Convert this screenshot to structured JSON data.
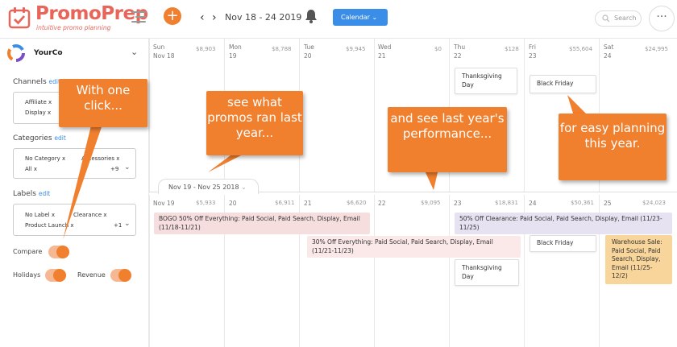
{
  "brand": {
    "name": "PromoPrep",
    "tagline": "intuitive promo planning"
  },
  "topbar": {
    "add": "+",
    "prev": "‹",
    "next": "›",
    "date_range": "Nov 18 - 24 2019",
    "view_label": "Calendar",
    "search_placeholder": "Search",
    "more": "···"
  },
  "sidebar": {
    "company": "YourCo",
    "channels": {
      "title": "Channels",
      "edit": "edit",
      "tags": [
        "Affiliate x",
        "Display x"
      ]
    },
    "categories": {
      "title": "Categories",
      "edit": "edit",
      "tags": [
        "No Category x",
        "Accessories x",
        "All x"
      ],
      "more": "+9"
    },
    "labels": {
      "title": "Labels",
      "edit": "edit",
      "tags": [
        "No Label x",
        "Clearance x",
        "Product Launch x"
      ],
      "more": "+1"
    },
    "compare": "Compare",
    "holidays": "Holidays",
    "revenue": "Revenue"
  },
  "week_current": [
    {
      "day": "Sun",
      "date": "Nov 18",
      "amount": "$8,903"
    },
    {
      "day": "Mon",
      "date": "19",
      "amount": "$8,788"
    },
    {
      "day": "Tue",
      "date": "20",
      "amount": "$9,945"
    },
    {
      "day": "Wed",
      "date": "21",
      "amount": "$0"
    },
    {
      "day": "Thu",
      "date": "22",
      "amount": "$128"
    },
    {
      "day": "Fri",
      "date": "23",
      "amount": "$55,604"
    },
    {
      "day": "Sat",
      "date": "24",
      "amount": "$24,995"
    }
  ],
  "current_cards": {
    "thanksgiving": "Thanksgiving Day",
    "black_friday": "Black Friday"
  },
  "compare_range": "Nov 19 - Nov 25 2018",
  "week_previous": [
    {
      "date": "Nov 19",
      "amount": "$5,933"
    },
    {
      "date": "20",
      "amount": "$6,911"
    },
    {
      "date": "21",
      "amount": "$6,620"
    },
    {
      "date": "22",
      "amount": "$9,095"
    },
    {
      "date": "23",
      "amount": "$18,831"
    },
    {
      "date": "24",
      "amount": "$50,361"
    },
    {
      "date": "25",
      "amount": "$24,023"
    }
  ],
  "previous_events": {
    "bogo": "BOGO 50% Off Everything: Paid Social, Paid Search, Display, Email (11/18-11/21)",
    "thirty": "30% Off Everything: Paid Social, Paid Search, Display, Email (11/21-11/23)",
    "clearance": "50% Off Clearance: Paid Social, Paid Search, Display, Email (11/23-11/25)",
    "black_friday": "Black Friday",
    "thanksgiving": "Thanksgiving Day",
    "warehouse": "Warehouse Sale: Paid Social, Paid Search, Display, Email (11/25-12/2)"
  },
  "callouts": {
    "one_click": "With one click...",
    "last_year": "see what promos ran last year...",
    "performance": "and see last year's performance...",
    "planning": "for easy planning this year."
  },
  "colors": {
    "accent": "#f07f2e",
    "brand": "#e8655a",
    "calendar_button": "#3a8ee8",
    "bogo": "#f6dede",
    "clearance": "#e7e2f2",
    "warehouse": "#f8d59a"
  }
}
